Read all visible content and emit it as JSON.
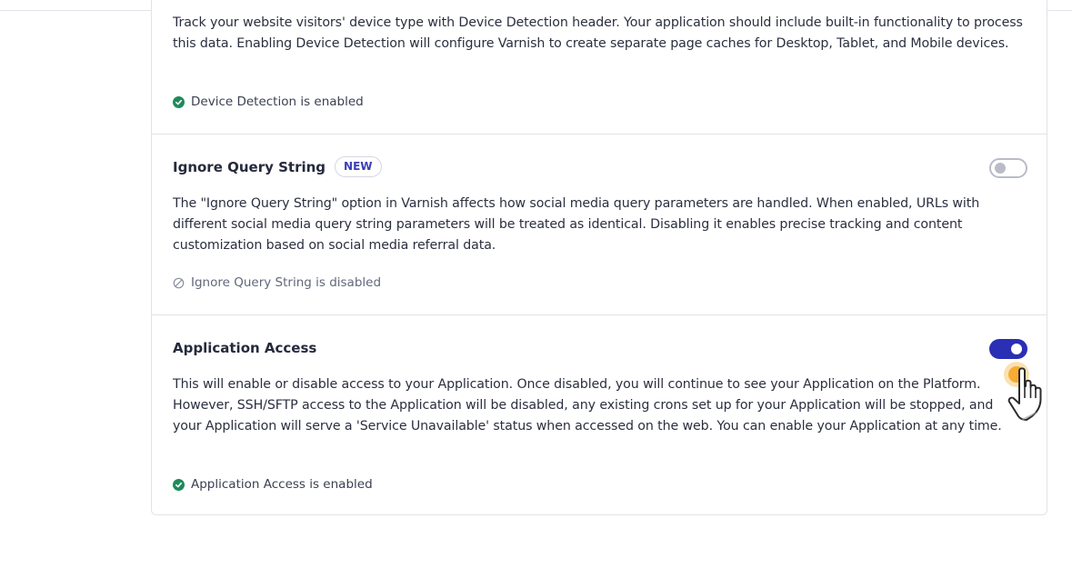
{
  "device_detection": {
    "description": "Track your website visitors' device type with Device Detection header. Your application should include built-in functionality to process this data. Enabling Device Detection will configure Varnish to create separate page caches for Desktop, Tablet, and Mobile devices.",
    "status": "Device Detection is enabled"
  },
  "ignore_query_string": {
    "title": "Ignore Query String",
    "badge": "NEW",
    "enabled": false,
    "description": "The \"Ignore Query String\" option in Varnish affects how social media query parameters are handled. When enabled, URLs with different social media query string parameters will be treated as identical. Disabling it enables precise tracking and content customization based on social media referral data.",
    "status": "Ignore Query String is disabled"
  },
  "application_access": {
    "title": "Application Access",
    "enabled": true,
    "description": "This will enable or disable access to your Application. Once disabled, you will continue to see your Application on the Platform. However, SSH/SFTP access to the Application will be disabled, any existing crons set up for your Application will be stopped, and your Application will serve a 'Service Unavailable' status when accessed on the web. You can enable your Application at any time.",
    "status": "Application Access is enabled"
  },
  "colors": {
    "accent": "#2a2fb5",
    "success": "#1f8a5b",
    "cursor_highlight": "#f5a623"
  },
  "icons": {
    "enabled_status": "check-circle-icon",
    "disabled_status": "ban-icon",
    "pointer": "hand-pointer-cursor"
  }
}
